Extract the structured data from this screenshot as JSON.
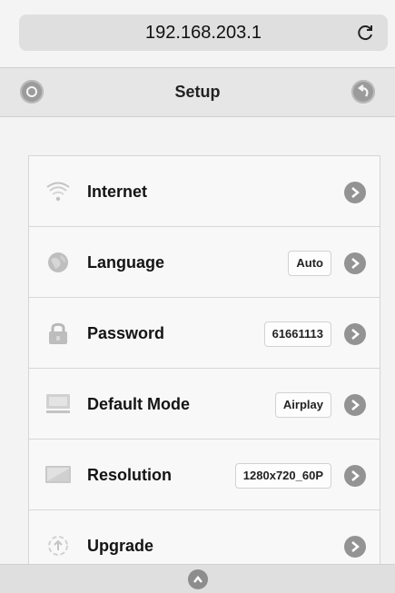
{
  "browser": {
    "address": "192.168.203.1",
    "reload_icon": "reload-icon"
  },
  "header": {
    "title": "Setup",
    "left_icon": "settings-icon",
    "right_icon": "back-icon"
  },
  "menu": {
    "items": [
      {
        "label": "Internet",
        "value": "",
        "icon": "wifi-icon"
      },
      {
        "label": "Language",
        "value": "Auto",
        "icon": "globe-icon"
      },
      {
        "label": "Password",
        "value": "61661113",
        "icon": "lock-icon"
      },
      {
        "label": "Default Mode",
        "value": "Airplay",
        "icon": "airplay-mode-icon"
      },
      {
        "label": "Resolution",
        "value": "1280x720_60P",
        "icon": "display-icon"
      },
      {
        "label": "Upgrade",
        "value": "",
        "icon": "upgrade-icon"
      }
    ]
  },
  "footer": {
    "icon": "scroll-up-icon"
  }
}
